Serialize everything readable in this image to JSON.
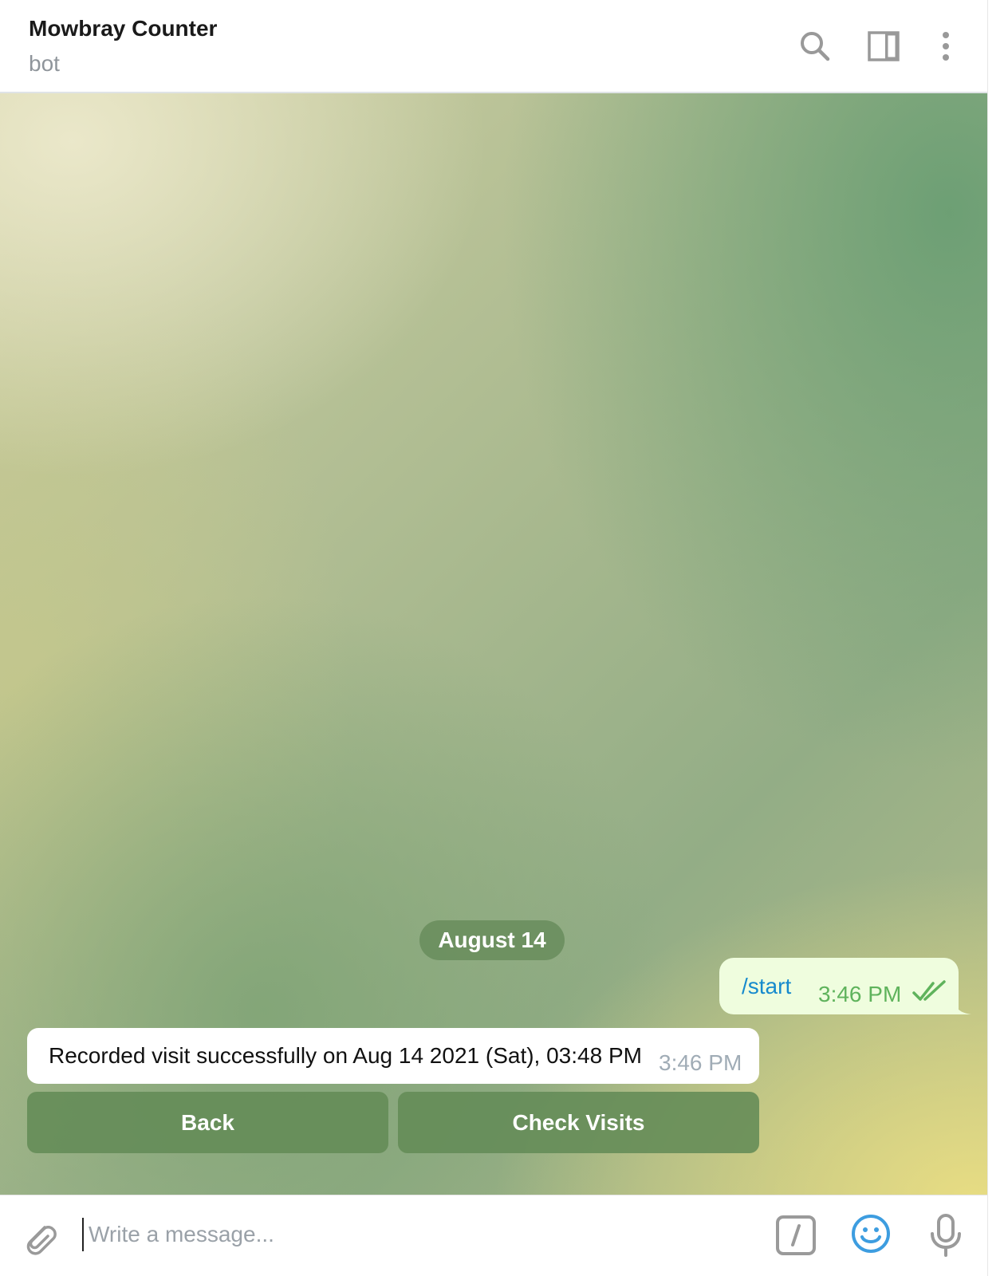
{
  "header": {
    "title": "Mowbray Counter",
    "subtitle": "bot",
    "icons": [
      "search-icon",
      "side-panel-icon",
      "more-vertical-icon"
    ]
  },
  "chat": {
    "date_separator": "August 14",
    "messages": [
      {
        "direction": "outgoing",
        "text": "/start",
        "time": "3:46 PM",
        "status": "read"
      },
      {
        "direction": "incoming",
        "text": "Recorded visit successfully on Aug 14 2021 (Sat), 03:48 PM",
        "time": "3:46 PM"
      }
    ],
    "keyboard": {
      "buttons": [
        "Back",
        "Check Visits"
      ]
    }
  },
  "composer": {
    "placeholder": "Write a message...",
    "value": "",
    "icons": [
      "paperclip-icon",
      "bot-command-icon",
      "emoji-icon",
      "microphone-icon"
    ]
  },
  "colors": {
    "accent": "#168acd",
    "outgoing_bubble": "#effdde",
    "outgoing_time": "#5fb35c",
    "keyboard_button": "#638b57",
    "emoji_icon": "#3d9de0"
  }
}
